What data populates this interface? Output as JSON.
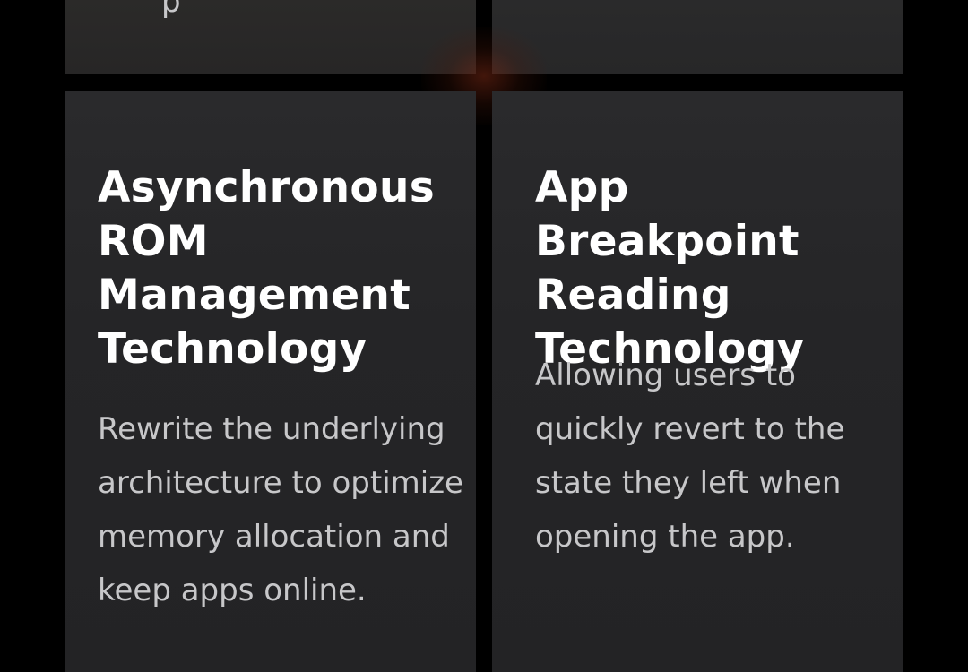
{
  "top_cards": {
    "left_fragment": "p"
  },
  "cards": [
    {
      "title": "Asynchronous ROM Management Technology",
      "description": "Rewrite the underlying architecture to optimize memory allocation and keep apps online."
    },
    {
      "title": "App Breakpoint Reading Technology",
      "description": "Allowing users to quickly revert to the state they left when opening the app."
    }
  ],
  "colors": {
    "background": "#000000",
    "card": "#262628",
    "title": "#ffffff",
    "text": "#c7c7c9"
  }
}
